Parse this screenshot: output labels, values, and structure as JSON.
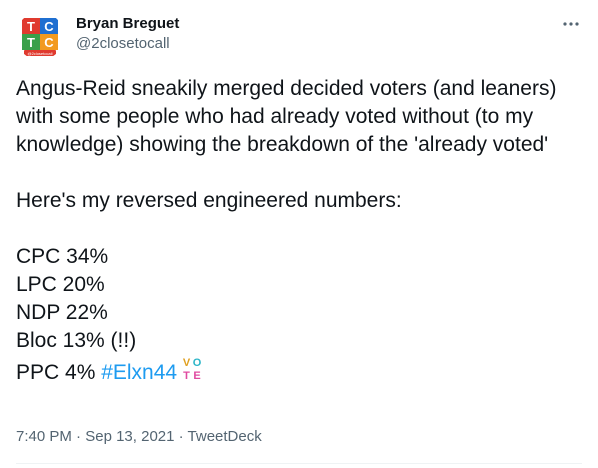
{
  "author": {
    "display_name": "Bryan Breguet",
    "handle": "@2closetocall",
    "avatar_letters": [
      "T",
      "C",
      "T",
      "C"
    ],
    "avatar_caption": "@2closetocall"
  },
  "tweet": {
    "paragraph_1": "Angus-Reid sneakily merged decided voters (and leaners) with some people who had already voted without (to my knowledge) showing the breakdown of the 'already voted'",
    "paragraph_2": "Here's my reversed engineered numbers:",
    "numbers": [
      "CPC 34%",
      "LPC 20%",
      "NDP 22%",
      "Bloc 13% (!!)"
    ],
    "last_line_prefix": "PPC 4% ",
    "hashtag": "#Elxn44",
    "hashtag_emoji_letters": [
      "V",
      "O",
      "T",
      "E"
    ]
  },
  "meta": {
    "time": "7:40 PM",
    "separator_1": " · ",
    "date": "Sep 13, 2021",
    "separator_2": " · ",
    "source": "TweetDeck"
  },
  "colors": {
    "text": "#0f1419",
    "secondary": "#536471",
    "link": "#1d9bf0",
    "divider": "#eff3f4",
    "avatar_red": "#e03a2f",
    "avatar_blue": "#1f6fd1",
    "avatar_orange": "#f29a1f",
    "avatar_green": "#3aa04a"
  },
  "icons": {
    "more": "more-horizontal-icon",
    "vote": "vote-emoji-icon"
  }
}
